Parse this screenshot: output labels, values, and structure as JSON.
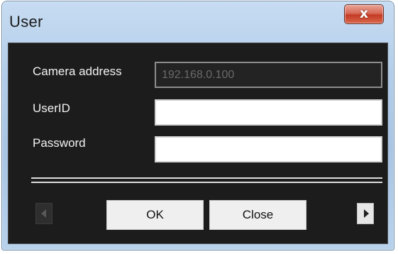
{
  "window": {
    "title": "User",
    "close_glyph": "x"
  },
  "form": {
    "camera_address": {
      "label": "Camera address",
      "value": "192.168.0.100"
    },
    "user_id": {
      "label": "UserID",
      "value": ""
    },
    "password": {
      "label": "Password",
      "value": ""
    }
  },
  "buttons": {
    "ok_label": "OK",
    "close_label": "Close",
    "prev_icon": "left-triangle",
    "next_icon": "right-triangle"
  },
  "colors": {
    "title_bar": "#b2cde9",
    "close_button": "#c43b24",
    "dialog_background": "#1c1c1c",
    "label_text": "#f2f2f2"
  }
}
